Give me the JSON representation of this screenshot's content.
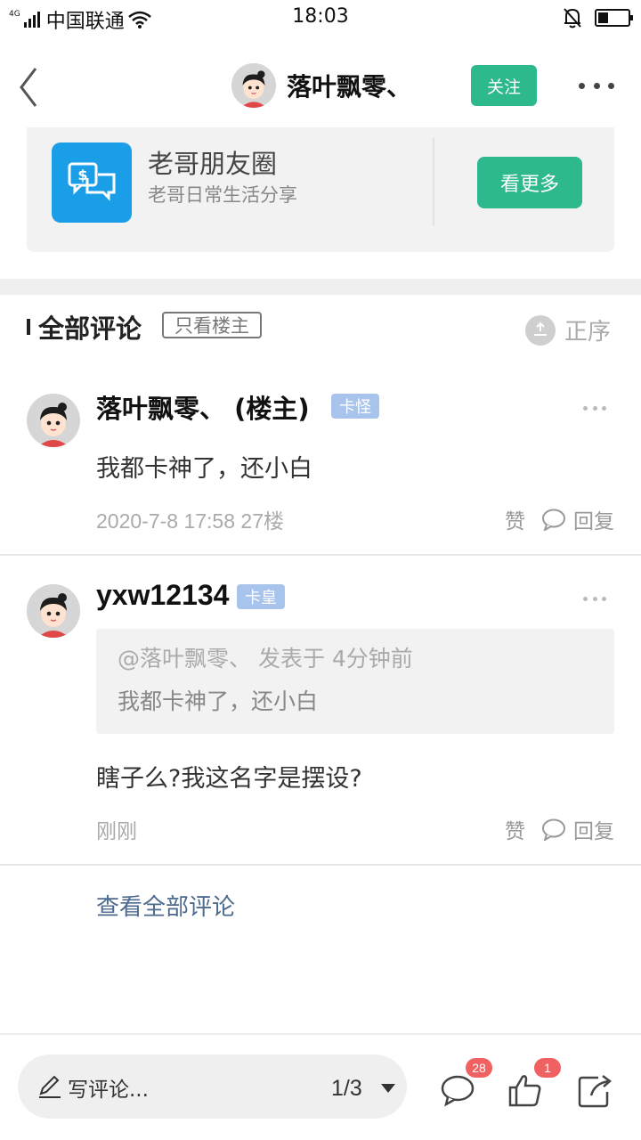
{
  "status_bar": {
    "signal_label": "4G",
    "carrier": "中国联通",
    "time": "18:03",
    "battery_percent": 35
  },
  "nav": {
    "author_name": "落叶飘零、",
    "follow_label": "关注"
  },
  "group_card": {
    "title": "老哥朋友圈",
    "subtitle": "老哥日常生活分享",
    "see_more_label": "看更多",
    "icon": "chat-dollar-icon"
  },
  "comments_header": {
    "title": "全部评论",
    "op_only_label": "只看楼主",
    "order_label": "正序"
  },
  "comments": [
    {
      "user": "落叶飘零、 (楼主)",
      "badge": "卡怪",
      "text": "我都卡神了，还小白",
      "meta": "2020-7-8 17:58  27楼",
      "like_label": "赞",
      "reply_label": "回复"
    },
    {
      "user": "yxw12134",
      "badge": "卡皇",
      "quote_head": "@落叶飘零、 发表于 4分钟前",
      "quote_body": "我都卡神了，还小白",
      "text": "瞎子么?我这名字是摆设?",
      "meta": "刚刚",
      "like_label": "赞",
      "reply_label": "回复"
    }
  ],
  "view_all_label": "查看全部评论",
  "bottom_bar": {
    "write_placeholder": "写评论...",
    "page_indicator": "1/3",
    "comment_count": "28",
    "like_count": "1"
  },
  "colors": {
    "accent_green": "#2db88d",
    "badge_blue": "#a8c4ec",
    "link_blue": "#4d6a8f",
    "count_red": "#f06161",
    "group_icon_blue": "#1a9ee8"
  }
}
